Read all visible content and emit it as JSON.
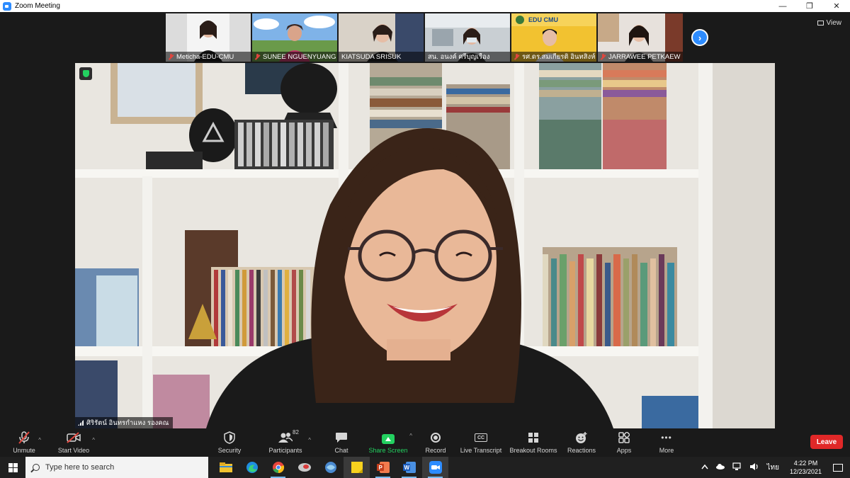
{
  "window": {
    "title": "Zoom Meeting",
    "controls": [
      "—",
      "❐",
      "✕"
    ]
  },
  "gallery": {
    "participants": [
      {
        "name": "Meticha-EDU-CMU",
        "muted": true,
        "bg": "#dcdcdc"
      },
      {
        "name": "SUNEE NGUENYUANG",
        "muted": true,
        "bg": "#6a9a4a"
      },
      {
        "name": "KIATSUDA SRISUK",
        "muted": false,
        "bg": "#d9d2c8"
      },
      {
        "name": "สน. อนงค์ ศรีบุญเรือง",
        "muted": false,
        "bg": "#c9cfd3"
      },
      {
        "name": "รศ.ดร.สมเกียรติ อินทสิงห์",
        "muted": true,
        "bg": "#f2c230",
        "logo_text": "EDU CMU"
      },
      {
        "name": "JARRAWEE PETKAEW",
        "muted": true,
        "bg": "#e7e1dc"
      }
    ],
    "next_icon": "›",
    "view_label": "View"
  },
  "main_video": {
    "speaker_name": "ศิริรัตน์ อินทรกำแหง รองคณ",
    "secure": true
  },
  "toolbar": {
    "unmute": "Unmute",
    "start_video": "Start Video",
    "security": "Security",
    "participants": "Participants",
    "participants_count": "82",
    "chat": "Chat",
    "share_screen": "Share Screen",
    "record": "Record",
    "live_transcript": "Live Transcript",
    "live_transcript_icon": "CC",
    "breakout_rooms": "Breakout Rooms",
    "reactions": "Reactions",
    "apps": "Apps",
    "more": "More",
    "more_icon": "•••",
    "leave": "Leave"
  },
  "taskbar": {
    "search_placeholder": "Type here to search",
    "apps": [
      "file-explorer",
      "edge",
      "chrome",
      "app-4",
      "app-5",
      "sticky-notes",
      "powerpoint",
      "word",
      "zoom"
    ],
    "tray": {
      "lang": "ไทย",
      "time": "4:22 PM",
      "date": "12/23/2021"
    }
  }
}
